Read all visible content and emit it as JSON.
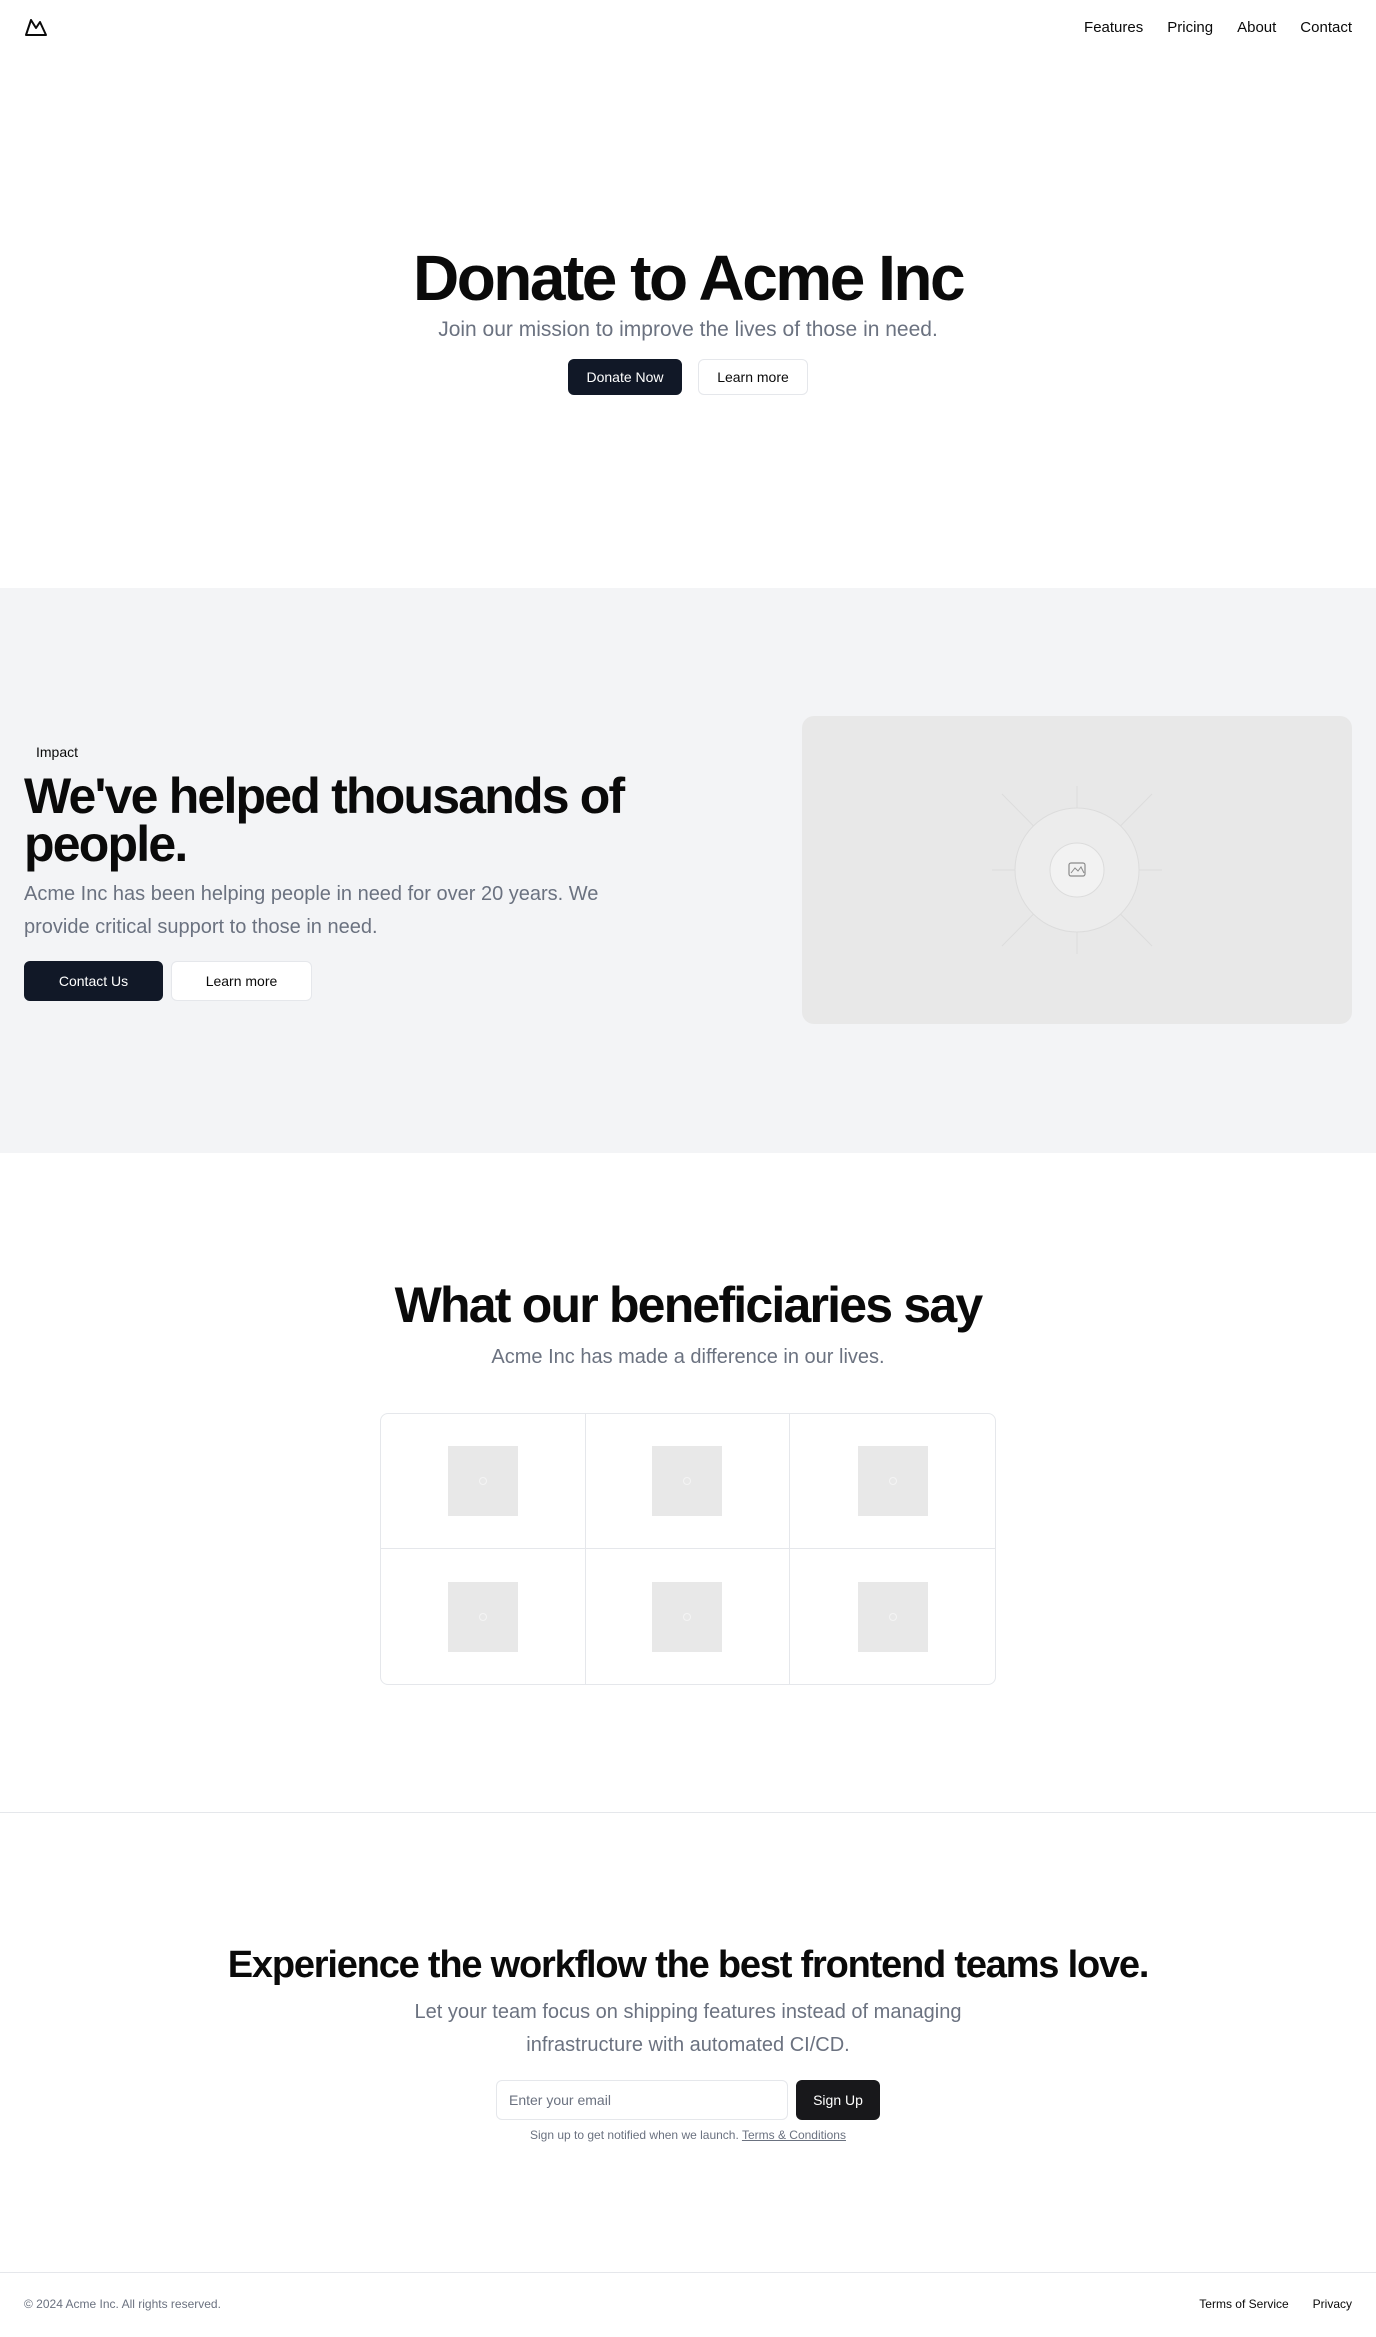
{
  "nav": {
    "logo_icon": "mountain-icon",
    "items": [
      "Features",
      "Pricing",
      "About",
      "Contact"
    ]
  },
  "hero": {
    "title": "Donate to Acme Inc",
    "subtitle": "Join our mission to improve the lives of those in need.",
    "primary_button": "Donate Now",
    "secondary_button": "Learn more"
  },
  "impact": {
    "badge": "Impact",
    "title": "We've helped thousands of people.",
    "description": "Acme Inc has been helping people in need for over 20 years. We provide critical support to those in need.",
    "primary_button": "Contact Us",
    "secondary_button": "Learn more",
    "image_icon": "image-placeholder-icon"
  },
  "testimonials": {
    "title": "What our beneficiaries say",
    "subtitle": "Acme Inc has made a difference in our lives.",
    "logos": [
      "logo-placeholder",
      "logo-placeholder",
      "logo-placeholder",
      "logo-placeholder",
      "logo-placeholder",
      "logo-placeholder"
    ]
  },
  "cta": {
    "title": "Experience the workflow the best frontend teams love.",
    "subtitle": "Let your team focus on shipping features instead of managing infrastructure with automated CI/CD.",
    "email_placeholder": "Enter your email",
    "button": "Sign Up",
    "note": "Sign up to get notified when we launch.",
    "note_link": "Terms & Conditions"
  },
  "footer": {
    "copyright": "© 2024 Acme Inc. All rights reserved.",
    "links": [
      "Terms of Service",
      "Privacy"
    ]
  },
  "colors": {
    "primary_dark": "#111827",
    "muted_text": "#6b7280",
    "section_bg": "#f3f4f6",
    "border": "#e5e7eb"
  }
}
